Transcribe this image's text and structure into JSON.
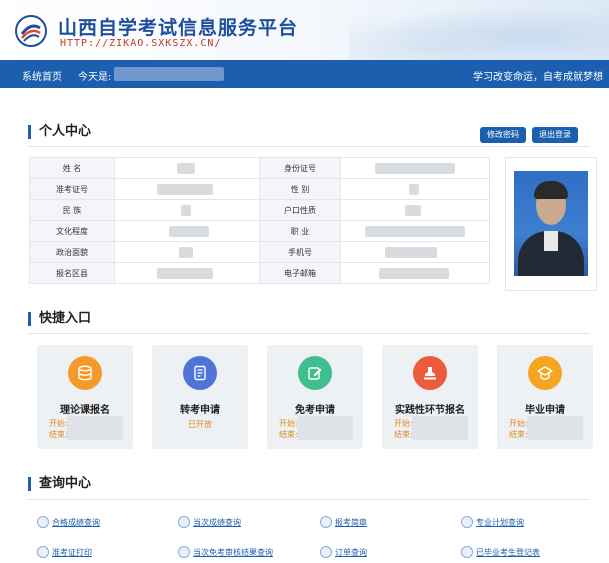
{
  "header": {
    "site_title": "山西自学考试信息服务平台",
    "site_url": "HTTP://ZIKAO.SXKSZX.CN/"
  },
  "nav": {
    "home": "系统首页",
    "date_label": "今天是:",
    "date_value": "",
    "slogan": "学习改变命运，自考成就梦想"
  },
  "personal": {
    "title": "个人中心",
    "change_password": "修改密码",
    "logout": "退出登录",
    "rows": [
      {
        "k1": "姓  名",
        "v1": "",
        "k2": "身份证号",
        "v2": ""
      },
      {
        "k1": "准考证号",
        "v1": "",
        "k2": "性  别",
        "v2": ""
      },
      {
        "k1": "民  族",
        "v1": "",
        "k2": "户口性质",
        "v2": ""
      },
      {
        "k1": "文化程度",
        "v1": "",
        "k2": "职  业",
        "v2": ""
      },
      {
        "k1": "政治面貌",
        "v1": "",
        "k2": "手机号",
        "v2": ""
      },
      {
        "k1": "报名区县",
        "v1": "",
        "k2": "电子邮箱",
        "v2": ""
      }
    ]
  },
  "quick": {
    "title": "快捷入口",
    "tiles": [
      {
        "name": "理论课报名",
        "start_label": "开始:",
        "end_label": "结束:",
        "color": "#f49a2a",
        "icon": "database-icon"
      },
      {
        "name": "转考申请",
        "status": "已开放",
        "color": "#4f74d6",
        "icon": "document-icon"
      },
      {
        "name": "免考申请",
        "start_label": "开始:",
        "end_label": "结束:",
        "color": "#3fbf8f",
        "icon": "edit-icon"
      },
      {
        "name": "实践性环节报名",
        "start_label": "开始:",
        "end_label": "结束:",
        "color": "#ee5a3c",
        "icon": "stamp-icon"
      },
      {
        "name": "毕业申请",
        "start_label": "开始:",
        "end_label": "结束:",
        "color": "#f4a623",
        "icon": "graduation-cap-icon"
      }
    ]
  },
  "query": {
    "title": "查询中心",
    "links": [
      "合格成绩查询",
      "当次成绩查询",
      "报考简章",
      "专业计划查询",
      "准考证打印",
      "当次免考审核结果查询",
      "订单查询",
      "已毕业考生登记表"
    ]
  }
}
